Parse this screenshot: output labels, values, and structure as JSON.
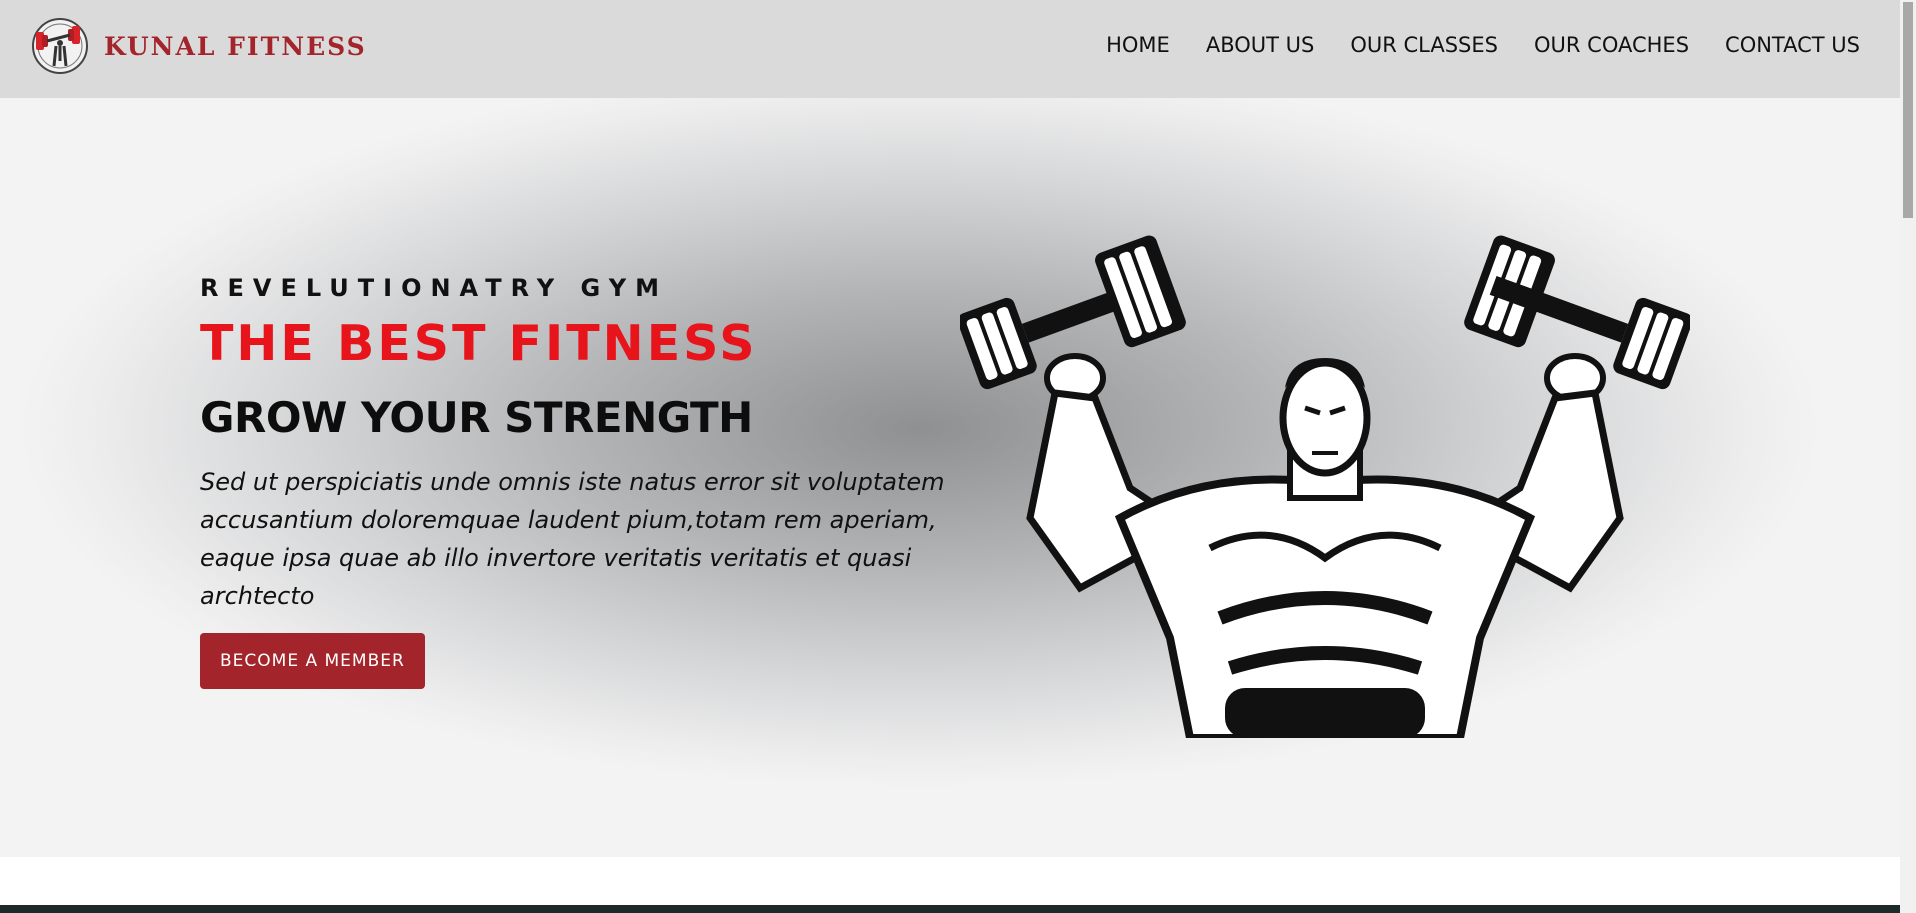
{
  "brand": {
    "name": "KUNAL FITNESS",
    "logo_icon": "dumbbell-logo-icon",
    "accent": "#a3252b"
  },
  "nav": {
    "items": [
      {
        "label": "HOME"
      },
      {
        "label": "ABOUT US"
      },
      {
        "label": "OUR CLASSES"
      },
      {
        "label": "OUR COACHES"
      },
      {
        "label": "CONTACT US"
      }
    ]
  },
  "hero": {
    "eyebrow": "REVELUTIONATRY GYM",
    "title": "THE BEST FITNESS",
    "subtitle": "GROW YOUR STRENGTH",
    "description": "Sed ut perspiciatis unde omnis iste natus error sit voluptatem accusantium doloremquae laudent pium,totam rem aperiam, eaque ipsa quae ab illo invertore veritatis veritatis et quasi archtecto",
    "cta_label": "BECOME A MEMBER",
    "title_color": "#e8141b",
    "image_icon": "bodybuilder-dumbbells-illustration"
  }
}
